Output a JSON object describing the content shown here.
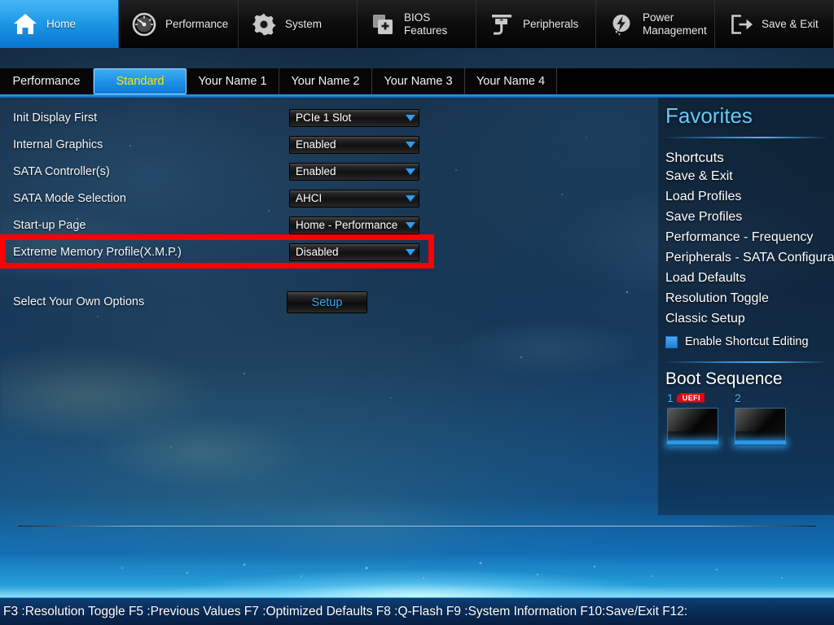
{
  "topnav": {
    "items": [
      {
        "label": "Home",
        "icon": "home-icon",
        "active": true
      },
      {
        "label": "Performance",
        "icon": "gauge-icon",
        "active": false
      },
      {
        "label": "System",
        "icon": "gear-icon",
        "active": false
      },
      {
        "label": "BIOS\nFeatures",
        "icon": "bios-chip-icon",
        "active": false
      },
      {
        "label": "Peripherals",
        "icon": "peripherals-icon",
        "active": false
      },
      {
        "label": "Power\nManagement",
        "icon": "power-bolt-icon",
        "active": false
      },
      {
        "label": "Save & Exit",
        "icon": "exit-door-icon",
        "active": false
      }
    ]
  },
  "tabs": [
    {
      "label": "Performance",
      "active": false
    },
    {
      "label": "Standard",
      "active": true
    },
    {
      "label": "Your Name 1",
      "active": false
    },
    {
      "label": "Your Name 2",
      "active": false
    },
    {
      "label": "Your Name 3",
      "active": false
    },
    {
      "label": "Your Name 4",
      "active": false
    }
  ],
  "settings": {
    "rows": [
      {
        "label": "Init Display First",
        "value": "PCIe 1 Slot"
      },
      {
        "label": "Internal Graphics",
        "value": "Enabled"
      },
      {
        "label": "SATA Controller(s)",
        "value": "Enabled"
      },
      {
        "label": "SATA Mode Selection",
        "value": "AHCI"
      },
      {
        "label": "Start-up Page",
        "value": "Home - Performance"
      },
      {
        "label": "Extreme Memory Profile(X.M.P.)",
        "value": "Disabled"
      }
    ],
    "setup_row": {
      "label": "Select Your Own Options",
      "button_label": "Setup"
    }
  },
  "highlight": {
    "color": "#ff0000",
    "target": "Extreme Memory Profile(X.M.P.)"
  },
  "sidebar": {
    "title": "Favorites",
    "shortcuts_heading": "Shortcuts",
    "shortcuts": [
      "Save & Exit",
      "Load Profiles",
      "Save Profiles",
      "Performance - Frequency",
      "Peripherals - SATA Configuration",
      "Load Defaults",
      "Resolution Toggle",
      "Classic Setup"
    ],
    "checkbox": {
      "label": "Enable Shortcut Editing",
      "checked": true
    },
    "boot": {
      "title": "Boot Sequence",
      "items": [
        {
          "number": "1",
          "badge": "UEFI"
        },
        {
          "number": "2",
          "badge": ""
        }
      ]
    }
  },
  "footer": {
    "text": "F3 :Resolution Toggle F5 :Previous Values F7 :Optimized Defaults F8 :Q-Flash F9 :System Information F10:Save/Exit F12:"
  },
  "colors": {
    "accent_blue": "#2a9df4",
    "tab_active_text": "#ffe400",
    "favorites_title": "#68c8f7",
    "highlight_red": "#ff0000",
    "setup_text": "#3ba7ef",
    "uefi_badge": "#e30613"
  }
}
